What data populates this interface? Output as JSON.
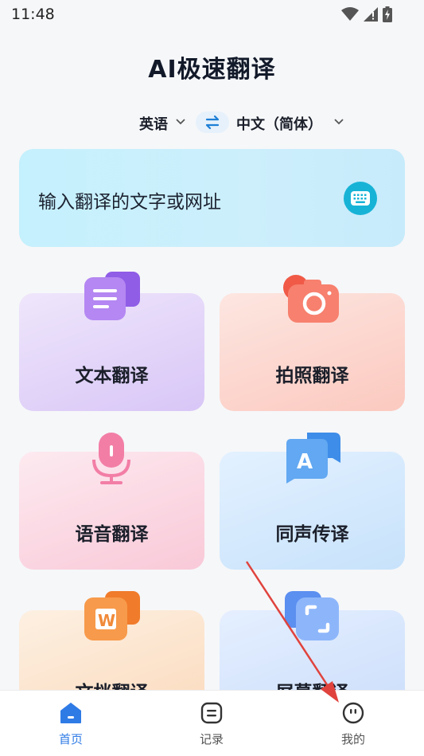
{
  "status_bar": {
    "time": "11:48"
  },
  "app": {
    "title": "AI极速翻译"
  },
  "language": {
    "source": "英语",
    "target": "中文（简体）"
  },
  "input": {
    "placeholder": "输入翻译的文字或网址"
  },
  "features": [
    {
      "label": "文本翻译"
    },
    {
      "label": "拍照翻译"
    },
    {
      "label": "语音翻译"
    },
    {
      "label": "同声传译"
    },
    {
      "label": "文档翻译"
    },
    {
      "label": "屏幕翻译"
    }
  ],
  "tabbar": [
    {
      "label": "首页"
    },
    {
      "label": "记录"
    },
    {
      "label": "我的"
    }
  ],
  "colors": {
    "accent": "#2f7be6",
    "keyboard": "#17b3d6",
    "annotation_arrow": "#e0433d"
  },
  "icons": {
    "status": [
      "wifi-icon",
      "signal-icon",
      "battery-icon"
    ],
    "features": [
      "text-doc-icon",
      "camera-icon",
      "microphone-icon",
      "translate-bubble-icon",
      "word-doc-icon",
      "screen-capture-icon"
    ],
    "tabs": [
      "home-icon",
      "record-icon",
      "profile-face-icon"
    ]
  }
}
